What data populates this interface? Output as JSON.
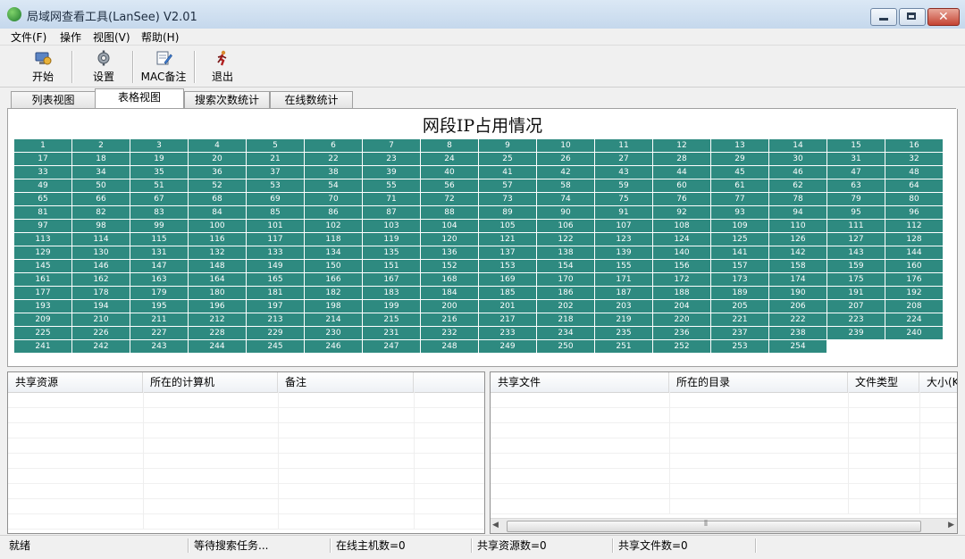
{
  "window": {
    "title": "局域网查看工具(LanSee) V2.01"
  },
  "menu": [
    "文件(F)",
    "操作",
    "视图(V)",
    "帮助(H)"
  ],
  "toolbar": {
    "start": "开始",
    "settings": "设置",
    "mac_note": "MAC备注",
    "exit": "退出"
  },
  "tabs": [
    "列表视图",
    "表格视图",
    "搜索次数统计",
    "在线数统计"
  ],
  "active_tab": "表格视图",
  "grid": {
    "title": "网段IP占用情况",
    "cell_color": "#2e8a80",
    "range_start": 1,
    "range_end": 254
  },
  "share_resources": {
    "columns": [
      "共享资源",
      "所在的计算机",
      "备注"
    ]
  },
  "share_files": {
    "columns": [
      "共享文件",
      "所在的目录",
      "文件类型",
      "大小(K"
    ]
  },
  "status": {
    "ready": "就绪",
    "waiting": "等待搜索任务...",
    "online_hosts": "在线主机数=0",
    "shared_resources": "共享资源数=0",
    "shared_files": "共享文件数=0"
  }
}
